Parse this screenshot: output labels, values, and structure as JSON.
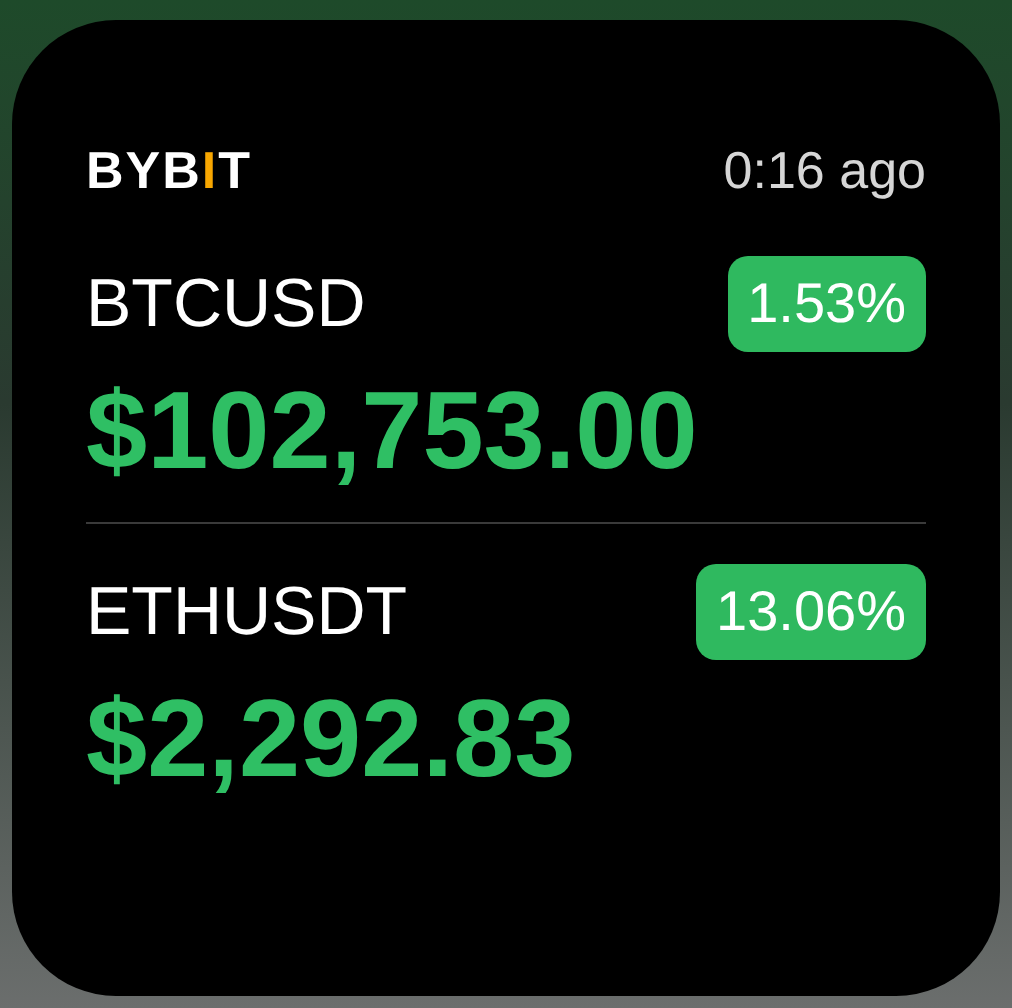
{
  "header": {
    "logo": [
      {
        "text": "BYB",
        "color": "#ffffff"
      },
      {
        "text": "I",
        "color": "#f7a600"
      },
      {
        "text": "T",
        "color": "#ffffff"
      }
    ],
    "updated": "0:16 ago"
  },
  "tickers": [
    {
      "symbol": "BTCUSD",
      "change": "1.53%",
      "price": "$102,753.00"
    },
    {
      "symbol": "ETHUSDT",
      "change": "13.06%",
      "price": "$2,292.83"
    }
  ]
}
